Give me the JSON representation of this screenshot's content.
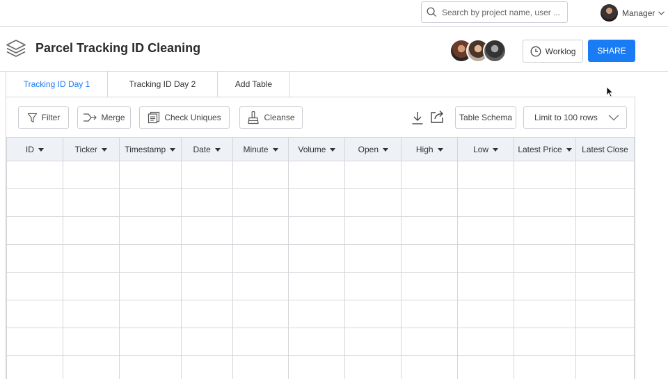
{
  "topbar": {
    "search_placeholder": "Search by project name, user ...",
    "user_name": "Manager"
  },
  "header": {
    "title": "Parcel Tracking ID Cleaning",
    "worklog_label": "Worklog",
    "share_label": "SHARE"
  },
  "tabs": [
    {
      "label": "Tracking ID Day 1",
      "active": true
    },
    {
      "label": "Tracking ID Day 2",
      "active": false
    },
    {
      "label": "Add Table",
      "active": false
    }
  ],
  "toolbar": {
    "filter_label": "Filter",
    "merge_label": "Merge",
    "check_uniques_label": "Check Uniques",
    "cleanse_label": "Cleanse",
    "table_schema_label": "Table Schema",
    "limit_label": "Limit to 100 rows"
  },
  "table": {
    "columns": [
      "ID",
      "Ticker",
      "Timestamp",
      "Date",
      "Minute",
      "Volume",
      "Open",
      "High",
      "Low",
      "Latest Price",
      "Latest Close"
    ]
  },
  "colors": {
    "accent": "#1a7cf5",
    "header_bg": "#eef1f6",
    "border": "#d4d6da"
  }
}
